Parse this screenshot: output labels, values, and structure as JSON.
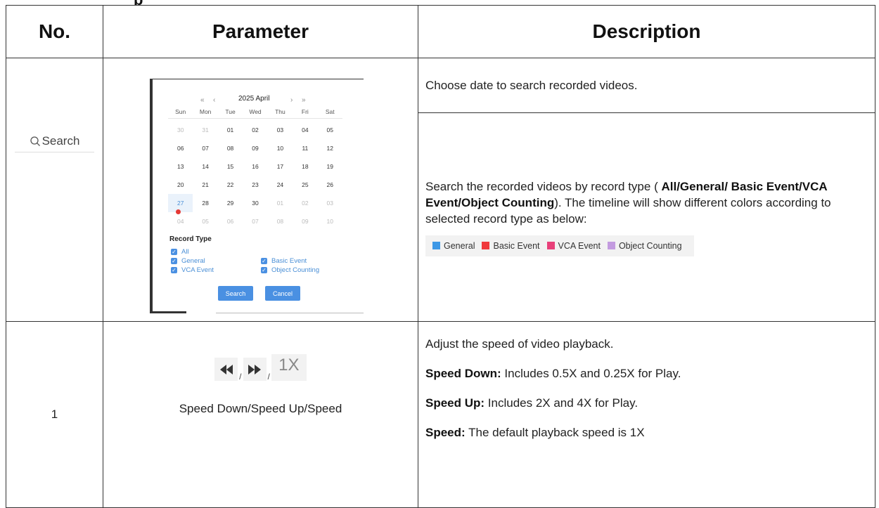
{
  "top_fragment": "p",
  "table": {
    "headers": {
      "no": "No.",
      "parameter": "Parameter",
      "description": "Description"
    }
  },
  "search_row": {
    "search_label": "Search",
    "desc1": "Choose date to search recorded videos.",
    "desc2_prefix": "Search the recorded videos by record type (",
    "desc2_bold": "All/General/ Basic Event/VCA Event/Object Counting",
    "desc2_suffix": "). The timeline will show different colors according to selected record type as below:",
    "legend": [
      {
        "label": "General",
        "color": "#3d98e6"
      },
      {
        "label": "Basic Event",
        "color": "#f0393d"
      },
      {
        "label": "VCA Event",
        "color": "#e8407a"
      },
      {
        "label": "Object Counting",
        "color": "#c39be0"
      }
    ]
  },
  "calendar": {
    "nav_prev_year": "«",
    "nav_prev_month": "‹",
    "nav_next_month": "›",
    "nav_next_year": "»",
    "title": "2025 April",
    "weekdays": [
      "Sun",
      "Mon",
      "Tue",
      "Wed",
      "Thu",
      "Fri",
      "Sat"
    ],
    "rows": [
      [
        "30",
        "31",
        "01",
        "02",
        "03",
        "04",
        "05"
      ],
      [
        "06",
        "07",
        "08",
        "09",
        "10",
        "11",
        "12"
      ],
      [
        "13",
        "14",
        "15",
        "16",
        "17",
        "18",
        "19"
      ],
      [
        "20",
        "21",
        "22",
        "23",
        "24",
        "25",
        "26"
      ],
      [
        "27",
        "28",
        "29",
        "30",
        "01",
        "02",
        "03"
      ],
      [
        "04",
        "05",
        "06",
        "07",
        "08",
        "09",
        "10"
      ]
    ],
    "muted": [
      [
        0,
        0
      ],
      [
        0,
        1
      ],
      [
        4,
        4
      ],
      [
        4,
        5
      ],
      [
        4,
        6
      ],
      [
        5,
        0
      ],
      [
        5,
        1
      ],
      [
        5,
        2
      ],
      [
        5,
        3
      ],
      [
        5,
        4
      ],
      [
        5,
        5
      ],
      [
        5,
        6
      ]
    ],
    "selected": [
      4,
      0
    ],
    "record_type_title": "Record Type",
    "checkbox_all": "All",
    "checkbox_general": "General",
    "checkbox_basic_event": "Basic Event",
    "checkbox_vca_event": "VCA Event",
    "checkbox_object_counting": "Object Counting",
    "search_button": "Search",
    "cancel_button": "Cancel"
  },
  "speed_row": {
    "no": "1",
    "sep": "/",
    "speed_label": "1X",
    "caption": "Speed Down/Speed Up/Speed",
    "desc_intro": "Adjust the speed of video playback.",
    "items": [
      {
        "term": "Speed Down:",
        "text": " Includes 0.5X and 0.25X for Play."
      },
      {
        "term": "Speed Up:",
        "text": " Includes 2X and 4X for Play."
      },
      {
        "term": "Speed:",
        "text": " The default playback speed is 1X"
      }
    ]
  }
}
